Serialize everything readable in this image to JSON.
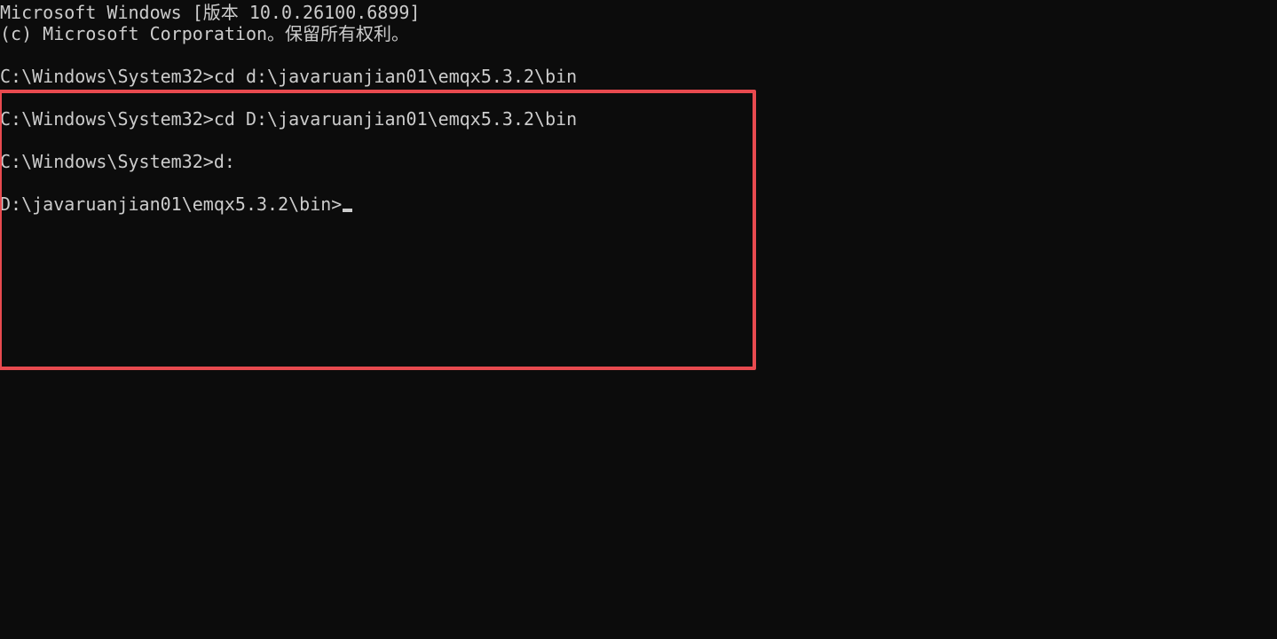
{
  "terminal": {
    "lines": [
      "Microsoft Windows [版本 10.0.26100.6899]",
      "(c) Microsoft Corporation。保留所有权利。",
      "C:\\Windows\\System32>cd d:\\javaruanjian01\\emqx5.3.2\\bin",
      "C:\\Windows\\System32>cd D:\\javaruanjian01\\emqx5.3.2\\bin",
      "C:\\Windows\\System32>d:",
      "D:\\javaruanjian01\\emqx5.3.2\\bin>"
    ],
    "background_color": "#0c0c0c",
    "text_color": "#cccccc"
  },
  "annotation": {
    "border_color": "#e84a4f"
  }
}
